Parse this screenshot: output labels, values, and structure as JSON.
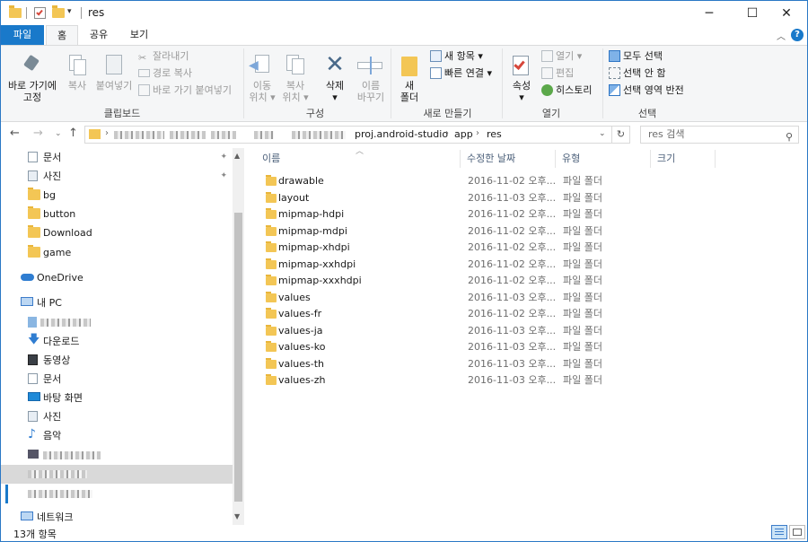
{
  "window": {
    "title": "res",
    "controls": {
      "minimize": "─",
      "maximize": "☐",
      "close": "✕"
    }
  },
  "ribbon_tabs": [
    "파일",
    "홈",
    "공유",
    "보기"
  ],
  "ribbon": {
    "clipboard": {
      "label": "클립보드",
      "pin": "바로 가기에\n고정",
      "copy": "복사",
      "paste": "붙여넣기",
      "cut": "잘라내기",
      "copy_path": "경로 복사",
      "paste_shortcut": "바로 가기 붙여넣기"
    },
    "organize": {
      "label": "구성",
      "move_to": "이동\n위치 ▾",
      "copy_to": "복사\n위치 ▾",
      "delete": "삭제\n▾",
      "rename": "이름\n바꾸기"
    },
    "new": {
      "label": "새로 만들기",
      "new_folder": "새\n폴더",
      "new_item": "새 항목 ▾",
      "easy_access": "빠른 연결 ▾"
    },
    "open": {
      "label": "열기",
      "properties": "속성\n▾",
      "open": "열기 ▾",
      "edit": "편집",
      "history": "히스토리"
    },
    "select": {
      "label": "선택",
      "select_all": "모두 선택",
      "select_none": "선택 안 함",
      "invert": "선택 영역 반전"
    }
  },
  "address": {
    "segments": [
      "proj.android-studio",
      "app",
      "res"
    ],
    "search_placeholder": "res 검색"
  },
  "nav": {
    "quick_access": [
      {
        "label": "문서",
        "icon": "document-icon",
        "pinned": true
      },
      {
        "label": "사진",
        "icon": "pictures-icon",
        "pinned": true
      },
      {
        "label": "bg",
        "icon": "folder-icon"
      },
      {
        "label": "button",
        "icon": "folder-icon"
      },
      {
        "label": "Download",
        "icon": "folder-icon"
      },
      {
        "label": "game",
        "icon": "folder-icon"
      }
    ],
    "onedrive": "OneDrive",
    "this_pc": "내 PC",
    "pc_items": [
      {
        "label": "다운로드",
        "icon": "download-icon"
      },
      {
        "label": "동영상",
        "icon": "video-icon"
      },
      {
        "label": "문서",
        "icon": "document-icon"
      },
      {
        "label": "바탕 화면",
        "icon": "desktop-icon"
      },
      {
        "label": "사진",
        "icon": "pictures-icon"
      },
      {
        "label": "음악",
        "icon": "music-icon"
      }
    ],
    "network": "네트워크",
    "pin_glyph": "📌"
  },
  "columns": {
    "name": "이름",
    "modified": "수정한 날짜",
    "type": "유형",
    "size": "크기"
  },
  "files": [
    {
      "name": "drawable",
      "modified": "2016-11-02 오후...",
      "type": "파일 폴더"
    },
    {
      "name": "layout",
      "modified": "2016-11-03 오후...",
      "type": "파일 폴더"
    },
    {
      "name": "mipmap-hdpi",
      "modified": "2016-11-02 오후...",
      "type": "파일 폴더"
    },
    {
      "name": "mipmap-mdpi",
      "modified": "2016-11-02 오후...",
      "type": "파일 폴더"
    },
    {
      "name": "mipmap-xhdpi",
      "modified": "2016-11-02 오후...",
      "type": "파일 폴더"
    },
    {
      "name": "mipmap-xxhdpi",
      "modified": "2016-11-02 오후...",
      "type": "파일 폴더"
    },
    {
      "name": "mipmap-xxxhdpi",
      "modified": "2016-11-02 오후...",
      "type": "파일 폴더"
    },
    {
      "name": "values",
      "modified": "2016-11-03 오후...",
      "type": "파일 폴더"
    },
    {
      "name": "values-fr",
      "modified": "2016-11-02 오후...",
      "type": "파일 폴더"
    },
    {
      "name": "values-ja",
      "modified": "2016-11-03 오후...",
      "type": "파일 폴더"
    },
    {
      "name": "values-ko",
      "modified": "2016-11-03 오후...",
      "type": "파일 폴더"
    },
    {
      "name": "values-th",
      "modified": "2016-11-03 오후...",
      "type": "파일 폴더"
    },
    {
      "name": "values-zh",
      "modified": "2016-11-03 오후...",
      "type": "파일 폴더"
    }
  ],
  "status": {
    "item_count": "13개 항목"
  },
  "colors": {
    "file_tab": "#1979ca",
    "folder": "#f3c655",
    "accent": "#1979ca",
    "selection": "#d9d9d9",
    "column_header": "#4c607a"
  }
}
